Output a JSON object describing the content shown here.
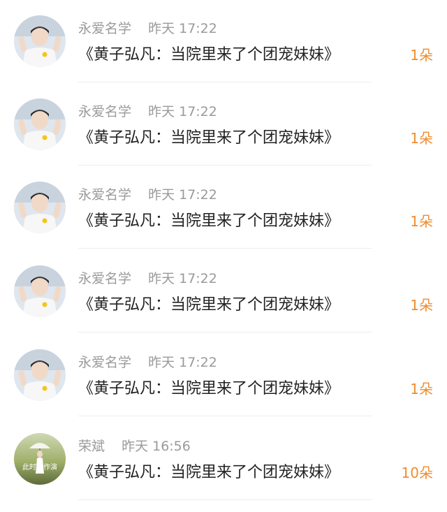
{
  "items": [
    {
      "name": "永爱名学",
      "time": "昨天 17:22",
      "title": "《黄子弘凡：当院里来了个团宠妹妹》",
      "count": "1朵",
      "avatar": "idol-avatar-icon"
    },
    {
      "name": "永爱名学",
      "time": "昨天 17:22",
      "title": "《黄子弘凡：当院里来了个团宠妹妹》",
      "count": "1朵",
      "avatar": "idol-avatar-icon"
    },
    {
      "name": "永爱名学",
      "time": "昨天 17:22",
      "title": "《黄子弘凡：当院里来了个团宠妹妹》",
      "count": "1朵",
      "avatar": "idol-avatar-icon"
    },
    {
      "name": "永爱名学",
      "time": "昨天 17:22",
      "title": "《黄子弘凡：当院里来了个团宠妹妹》",
      "count": "1朵",
      "avatar": "idol-avatar-icon"
    },
    {
      "name": "永爱名学",
      "time": "昨天 17:22",
      "title": "《黄子弘凡：当院里来了个团宠妹妹》",
      "count": "1朵",
      "avatar": "idol-avatar-icon"
    },
    {
      "name": "荣斌",
      "time": "昨天 16:56",
      "title": "《黄子弘凡：当院里来了个团宠妹妹》",
      "count": "10朵",
      "avatar": "umbrella-girl-avatar-icon",
      "avatar_text": "此时文作演"
    }
  ],
  "colors": {
    "count": "#f08c2e",
    "name": "#9a9a9a",
    "title": "#222222",
    "divider": "#ededed"
  }
}
